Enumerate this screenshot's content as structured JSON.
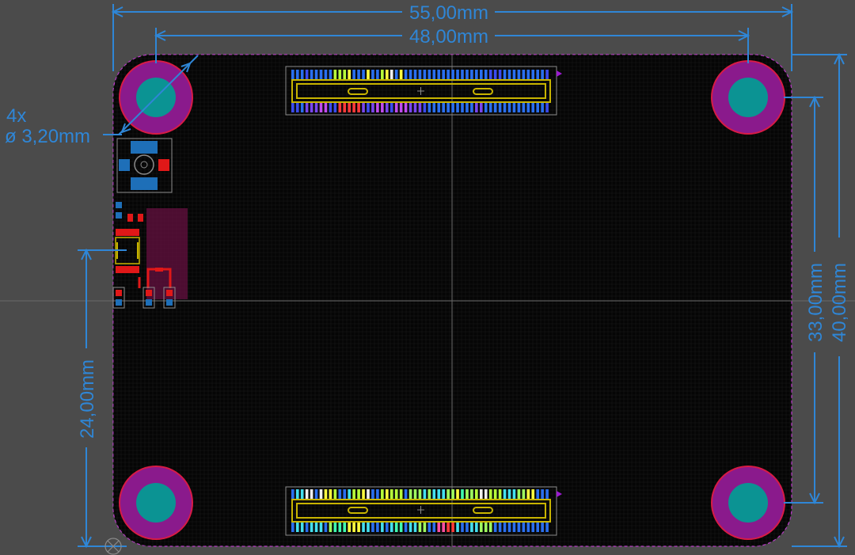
{
  "dimensions": {
    "board_width": "55,00mm",
    "hole_spacing_x": "48,00mm",
    "board_height": "40,00mm",
    "hole_spacing_y": "33,00mm",
    "origin_offset_y": "24,00mm",
    "hole_count": "4x",
    "hole_diameter": "ø 3,20mm"
  },
  "colors": {
    "background": "#4b4b4b",
    "board": "#050505",
    "grid": "#1a1a1a",
    "dimension": "#2f86d6",
    "hole_ring": "#8a1a8c",
    "hole_ring_edge": "#d81b45",
    "hole_drill": "#0b9393",
    "silkscreen": "#c8b400",
    "pad_blue": "#1e6fb8",
    "pad_red": "#e01818",
    "courtyard": "#8b8b8b",
    "outline_dash": "#c23ad0",
    "copper_zone": "#5a0f3a"
  },
  "pin_palette": [
    "#2a6ff0",
    "#3b4cf0",
    "#7a46f0",
    "#c14cf0",
    "#f0f0f0",
    "#b8ff3a",
    "#ffff40",
    "#44e0f0",
    "#ff3a3a",
    "#ff4fa0",
    "#40ffb0",
    "#a0ff60"
  ],
  "icons": {
    "origin_marker": "origin-crosshair-icon"
  }
}
